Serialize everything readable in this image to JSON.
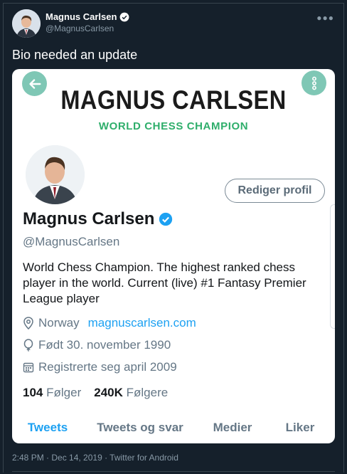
{
  "tweet": {
    "author_name": "Magnus Carlsen",
    "author_handle": "@MagnusCarlsen",
    "text": "Bio needed an update",
    "footer": "2:48 PM · Dec 14, 2019 · Twitter for Android",
    "icons": {
      "more": "more-icon",
      "verified": "verified-badge-icon"
    }
  },
  "card": {
    "brand_title": "MAGNUS CARLSEN",
    "brand_subtitle": "WORLD CHESS CHAMPION",
    "edit_button": "Rediger profil",
    "name": "Magnus Carlsen",
    "handle": "@MagnusCarlsen",
    "bio": "World Chess Champion. The highest ranked chess player in the world. Current (live) #1 Fantasy Premier League player",
    "location": "Norway",
    "website": "magnuscarlsen.com",
    "birth": "Født 30. november 1990",
    "joined": "Registrerte seg april 2009",
    "following_count": "104",
    "following_label": "Følger",
    "followers_count": "240K",
    "followers_label": "Følgere",
    "tabs": [
      "Tweets",
      "Tweets og svar",
      "Medier",
      "Liker"
    ],
    "active_tab": "Tweets"
  },
  "colors": {
    "background": "#15202b",
    "accent": "#1da1f2",
    "brand_green": "#2fae6b",
    "nav_button": "#7fc7b5"
  }
}
